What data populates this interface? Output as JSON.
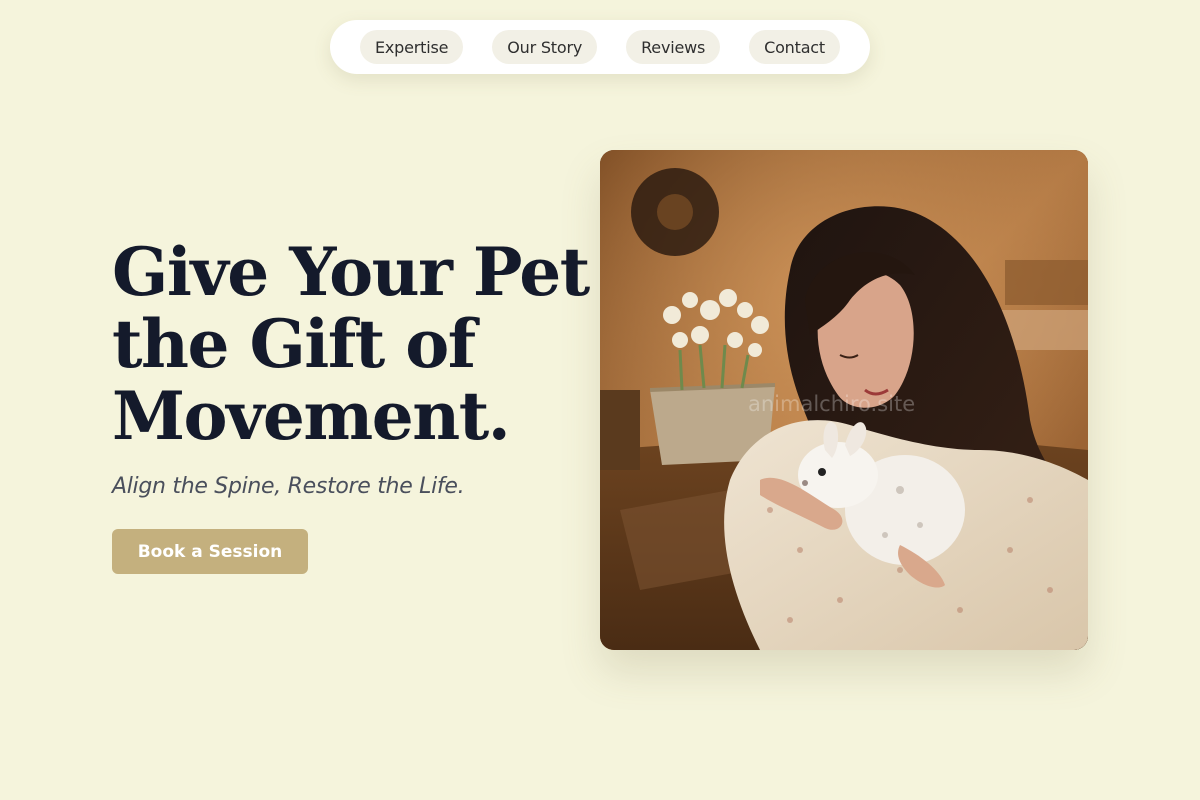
{
  "nav": {
    "items": [
      {
        "label": "Expertise"
      },
      {
        "label": "Our Story"
      },
      {
        "label": "Reviews"
      },
      {
        "label": "Contact"
      }
    ]
  },
  "hero": {
    "title_lines": [
      "Give Your Pet",
      "the Gift of",
      "Movement."
    ],
    "subtitle": "Align the Spine, Restore the Life.",
    "cta_label": "Book a Session"
  },
  "photo": {
    "watermark": "animalchiro.site"
  },
  "colors": {
    "background": "#f5f4dc",
    "title": "#141a2b",
    "accent": "#c4b07e",
    "nav_pill": "#f2f0e6"
  }
}
